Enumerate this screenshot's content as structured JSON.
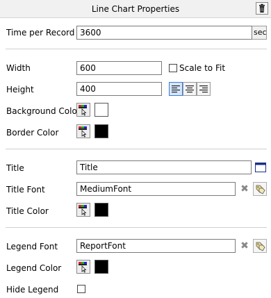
{
  "panel": {
    "title": "Line Chart Properties"
  },
  "time_per_record": {
    "label": "Time per Record",
    "value": "3600",
    "unit": "sec"
  },
  "width": {
    "label": "Width",
    "value": "600"
  },
  "scale_to_fit": {
    "label": "Scale to Fit",
    "checked": false
  },
  "height": {
    "label": "Height",
    "value": "400"
  },
  "alignment": {
    "options": [
      "left",
      "center",
      "right"
    ],
    "selected": "left"
  },
  "background_color": {
    "label": "Background Color",
    "color": "#ffffff"
  },
  "border_color": {
    "label": "Border Color",
    "color": "#000000"
  },
  "title": {
    "label": "Title",
    "value": "Title"
  },
  "title_font": {
    "label": "Title Font",
    "value": "MediumFont"
  },
  "title_color": {
    "label": "Title Color",
    "color": "#000000"
  },
  "legend_font": {
    "label": "Legend Font",
    "value": "ReportFont"
  },
  "legend_color": {
    "label": "Legend Color",
    "color": "#000000"
  },
  "hide_legend": {
    "label": "Hide Legend",
    "checked": false
  },
  "icons": {
    "delete": "trash-icon",
    "color_picker": "color-picker-icon",
    "clear": "clear-x-icon",
    "font_picker": "font-picker-icon",
    "title_edit": "title-editor-icon"
  }
}
